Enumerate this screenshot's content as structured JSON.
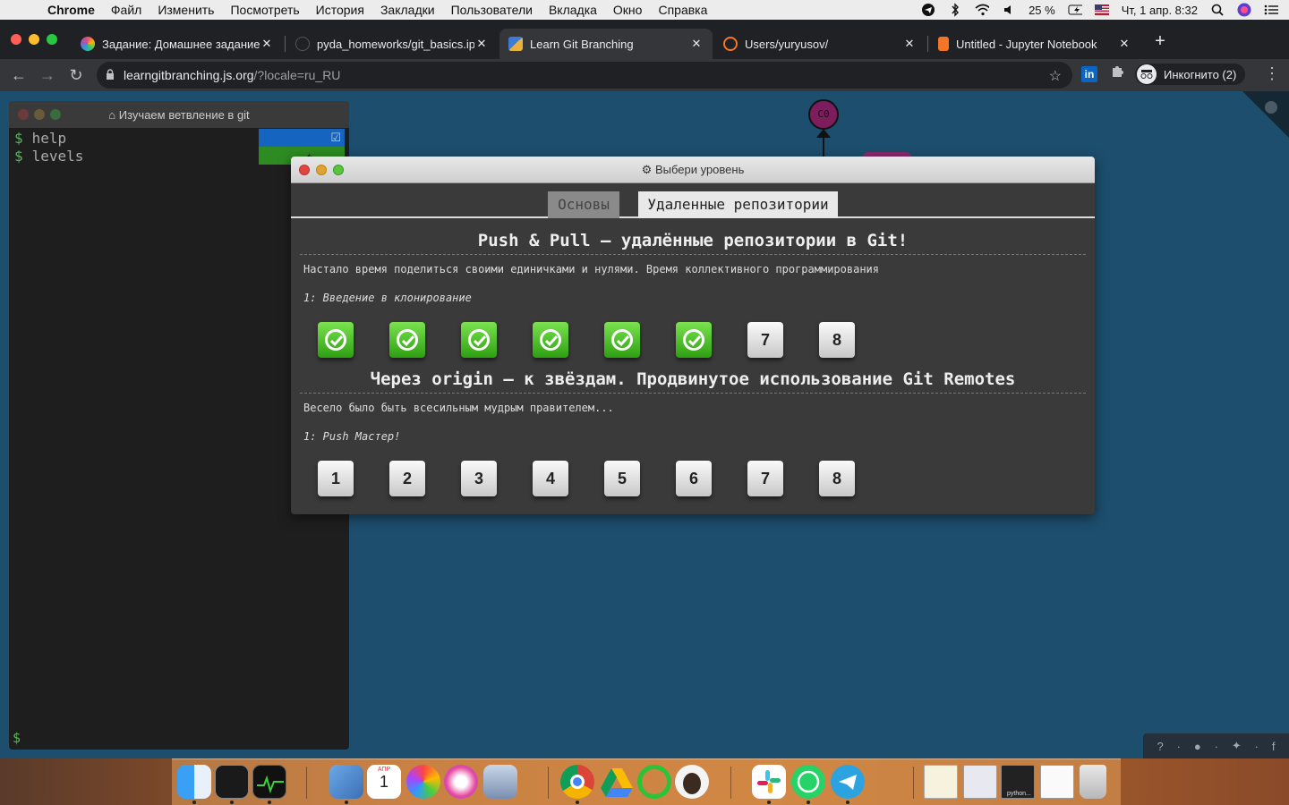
{
  "menubar": {
    "app": "Chrome",
    "items": [
      "Файл",
      "Изменить",
      "Посмотреть",
      "История",
      "Закладки",
      "Пользователи",
      "Вкладка",
      "Окно",
      "Справка"
    ],
    "battery": "25 %",
    "datetime": "Чт, 1 апр.  8:32"
  },
  "tabs": [
    {
      "title": "Задание: Домашнее задание",
      "favicon_color": "#e94e77"
    },
    {
      "title": "pyda_homeworks/git_basics.ip",
      "favicon_color": "#444444"
    },
    {
      "title": "Learn Git Branching",
      "favicon_color": "#3d7bd9"
    },
    {
      "title": "Users/yuryusov/",
      "favicon_color": "#f37626"
    },
    {
      "title": "Untitled - Jupyter Notebook",
      "favicon_color": "#f37626"
    }
  ],
  "toolbar": {
    "url_host": "learngitbranching.js.org",
    "url_path": "/?locale=ru_RU",
    "incognito": "Инкогнито (2)"
  },
  "graph": {
    "commit_label": "C0"
  },
  "terminal": {
    "title": "Изучаем ветвление в git",
    "lines": [
      "help",
      "levels"
    ],
    "prompt": "$",
    "goal_label": "↰"
  },
  "dialog": {
    "title": "Выбери уровень",
    "tabs": [
      "Основы",
      "Удаленные репозитории"
    ],
    "sections": [
      {
        "title": "Push & Pull — удалённые репозитории в Git!",
        "description": "Настало время поделиться своими единичками и нулями. Время коллективного программирования",
        "subtitle": "1: Введение в клонирование",
        "levels": [
          {
            "label": "1",
            "done": true
          },
          {
            "label": "2",
            "done": true
          },
          {
            "label": "3",
            "done": true
          },
          {
            "label": "4",
            "done": true
          },
          {
            "label": "5",
            "done": true
          },
          {
            "label": "6",
            "done": true
          },
          {
            "label": "7",
            "done": false
          },
          {
            "label": "8",
            "done": false
          }
        ]
      },
      {
        "title": "Через origin – к звёздам. Продвинутое использование Git Remotes",
        "description": "Весело было быть всесильным мудрым правителем...",
        "subtitle": "1: Push Мастер!",
        "levels": [
          {
            "label": "1",
            "done": false
          },
          {
            "label": "2",
            "done": false
          },
          {
            "label": "3",
            "done": false
          },
          {
            "label": "4",
            "done": false
          },
          {
            "label": "5",
            "done": false
          },
          {
            "label": "6",
            "done": false
          },
          {
            "label": "7",
            "done": false
          },
          {
            "label": "8",
            "done": false
          }
        ]
      }
    ]
  },
  "dock": {
    "apps": [
      "finder-icon",
      "terminal-icon",
      "activity-monitor-icon",
      "preview-icon",
      "calendar-icon",
      "photos-icon",
      "itunes-icon",
      "image-capture-icon",
      "chrome-icon",
      "google-drive-icon",
      "circle-app-icon",
      "bear-app-icon",
      "slack-icon",
      "whatsapp-icon",
      "telegram-icon",
      "notes-doc-icon",
      "screenshot-icon",
      "python-window-icon",
      "chrome-window-icon",
      "trash-icon"
    ],
    "calendar_day": "1",
    "calendar_month": "АПР",
    "python_label": "python..."
  }
}
